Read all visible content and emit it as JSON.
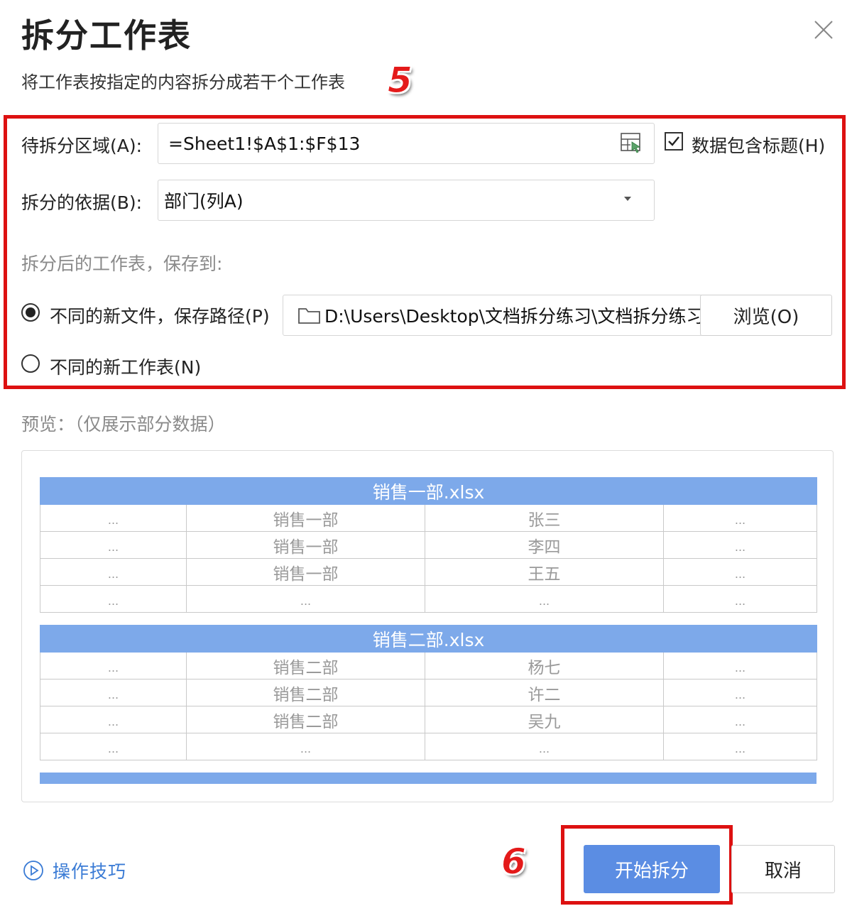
{
  "dialog": {
    "title": "拆分工作表",
    "subtitle": "将工作表按指定的内容拆分成若干个工作表",
    "close_icon": "close-icon"
  },
  "annotations": {
    "step5": "5",
    "step6": "6"
  },
  "form": {
    "range_label": "待拆分区域(A):",
    "range_value": "=Sheet1!$A$1:$F$13",
    "range_picker_icon": "range-select-icon",
    "header_checkbox_label": "数据包含标题(H)",
    "header_checkbox_checked": true,
    "basis_label": "拆分的依据(B):",
    "basis_value": "部门(列A)",
    "save_to_label": "拆分后的工作表，保存到:",
    "option_new_files_label": "不同的新文件，保存路径(P)",
    "option_new_files_selected": true,
    "path_value": "D:\\Users\\Desktop\\文档拆分练习\\文档拆分练习",
    "folder_icon": "folder-icon",
    "browse_label": "浏览(O)",
    "option_new_sheets_label": "不同的新工作表(N)",
    "option_new_sheets_selected": false
  },
  "preview": {
    "label": "预览：（仅展示部分数据）",
    "tables": [
      {
        "title": "销售一部.xlsx",
        "rows": [
          [
            "...",
            "销售一部",
            "张三",
            "..."
          ],
          [
            "...",
            "销售一部",
            "李四",
            "..."
          ],
          [
            "...",
            "销售一部",
            "王五",
            "..."
          ],
          [
            "...",
            "...",
            "...",
            "..."
          ]
        ]
      },
      {
        "title": "销售二部.xlsx",
        "rows": [
          [
            "...",
            "销售二部",
            "杨七",
            "..."
          ],
          [
            "...",
            "销售二部",
            "许二",
            "..."
          ],
          [
            "...",
            "销售二部",
            "吴九",
            "..."
          ],
          [
            "...",
            "...",
            "...",
            "..."
          ]
        ]
      }
    ]
  },
  "footer": {
    "tips_label": "操作技巧",
    "tips_icon": "play-circle-icon",
    "start_label": "开始拆分",
    "cancel_label": "取消"
  },
  "colors": {
    "accent": "#5b8de3",
    "table_header": "#7da9ea",
    "annotation_red": "#dd1111",
    "link": "#3a7bd5"
  }
}
